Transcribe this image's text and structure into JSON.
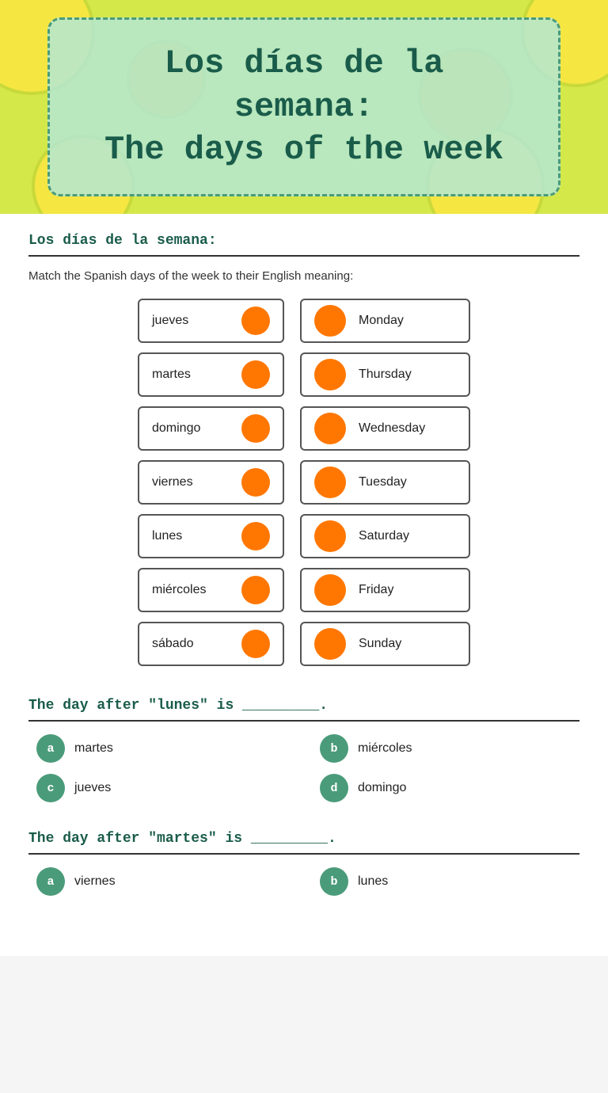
{
  "header": {
    "title_line1": "Los días de la semana:",
    "title_line2": "The days of the week"
  },
  "section1": {
    "title": "Los días de la semana:",
    "instructions": "Match the Spanish days of the week to their English meaning:"
  },
  "matching": {
    "pairs": [
      {
        "spanish": "jueves",
        "english": "Monday"
      },
      {
        "spanish": "martes",
        "english": "Thursday"
      },
      {
        "spanish": "domingo",
        "english": "Wednesday"
      },
      {
        "spanish": "viernes",
        "english": "Tuesday"
      },
      {
        "spanish": "lunes",
        "english": "Saturday"
      },
      {
        "spanish": "miércoles",
        "english": "Friday"
      },
      {
        "spanish": "sábado",
        "english": "Sunday"
      }
    ]
  },
  "question1": {
    "text": "The day after \"lunes\" is _________.",
    "choices": [
      {
        "letter": "a",
        "text": "martes"
      },
      {
        "letter": "b",
        "text": "miércoles"
      },
      {
        "letter": "c",
        "text": "jueves"
      },
      {
        "letter": "d",
        "text": "domingo"
      }
    ]
  },
  "question2": {
    "text": "The day after \"martes\" is _________.",
    "choices": [
      {
        "letter": "a",
        "text": "viernes"
      },
      {
        "letter": "b",
        "text": "lunes"
      }
    ]
  }
}
